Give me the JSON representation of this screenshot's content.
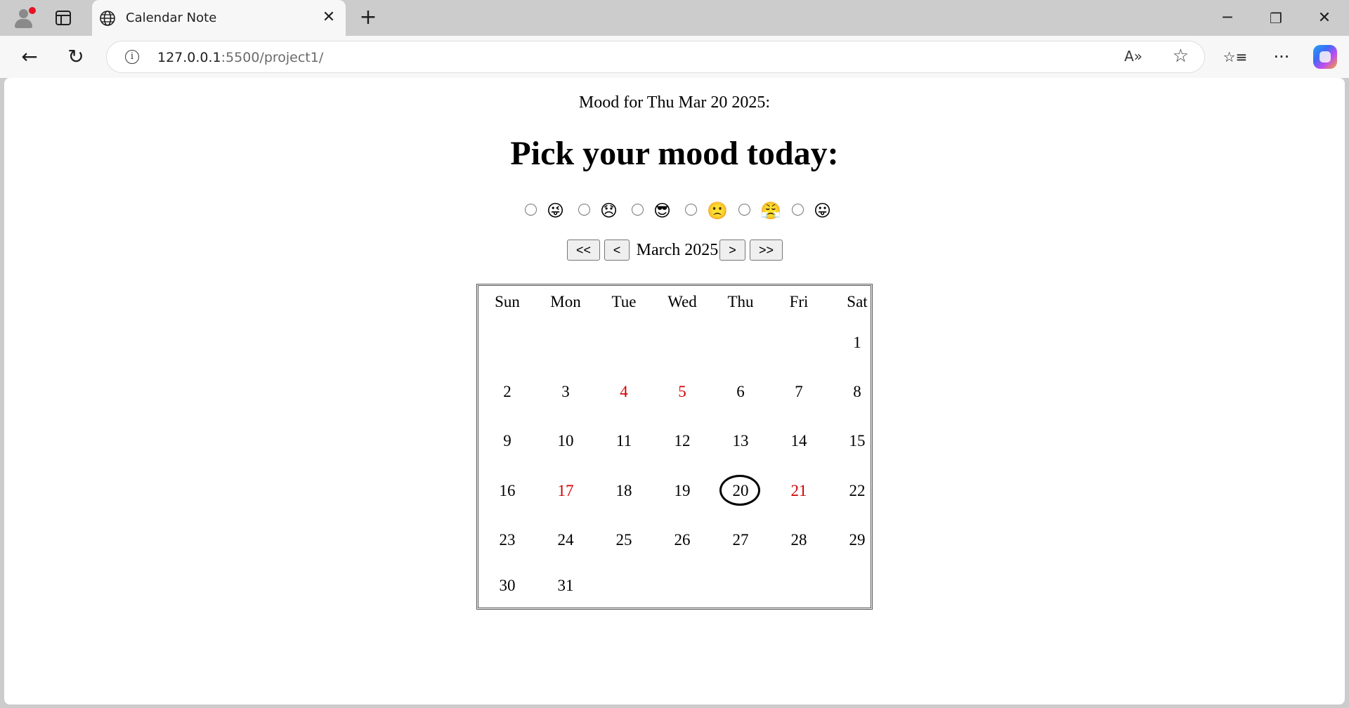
{
  "browser": {
    "tab_title": "Calendar Note",
    "url_host": "127.0.0.1",
    "url_rest": ":5500/project1/",
    "new_tab_glyph": "+",
    "close_tab_glyph": "✕",
    "icons": [
      "profile-icon",
      "workspaces-icon",
      "globe-icon",
      "back-icon",
      "refresh-icon",
      "info-icon",
      "read-aloud-icon",
      "favorite-star-icon",
      "favorites-icon",
      "more-icon",
      "copilot-icon",
      "minimize-icon",
      "restore-icon",
      "close-icon"
    ],
    "window": {
      "minimize": "─",
      "restore": "❐",
      "close": "✕"
    },
    "toolbar": {
      "back": "←",
      "refresh": "↻",
      "info": "i",
      "read_aloud": "A»",
      "star": "☆",
      "favorites": "☆≡",
      "more": "···"
    }
  },
  "page": {
    "mood_date_text": "Mood for Thu Mar 20 2025:",
    "heading": "Pick your mood today:",
    "mood_options": [
      {
        "emoji": "😜"
      },
      {
        "emoji": "😞"
      },
      {
        "emoji": "😎"
      },
      {
        "emoji": "🙁"
      },
      {
        "emoji": "😤"
      },
      {
        "emoji": "😛"
      }
    ],
    "nav": {
      "prev_year": "<<",
      "prev_month": "<",
      "month_label": "March 2025",
      "next_month": ">",
      "next_year": ">>"
    },
    "calendar": {
      "weekdays": [
        "Sun",
        "Mon",
        "Tue",
        "Wed",
        "Thu",
        "Fri",
        "Sat"
      ],
      "first_weekday_index": 6,
      "days_in_month": 31,
      "today": 20,
      "highlighted_days": [
        4,
        5,
        17,
        21
      ],
      "highlight_color": "#d10000",
      "days": [
        "1",
        "2",
        "3",
        "4",
        "5",
        "6",
        "7",
        "8",
        "9",
        "10",
        "11",
        "12",
        "13",
        "14",
        "15",
        "16",
        "17",
        "18",
        "19",
        "20",
        "21",
        "22",
        "23",
        "24",
        "25",
        "26",
        "27",
        "28",
        "29",
        "30",
        "31"
      ]
    }
  }
}
